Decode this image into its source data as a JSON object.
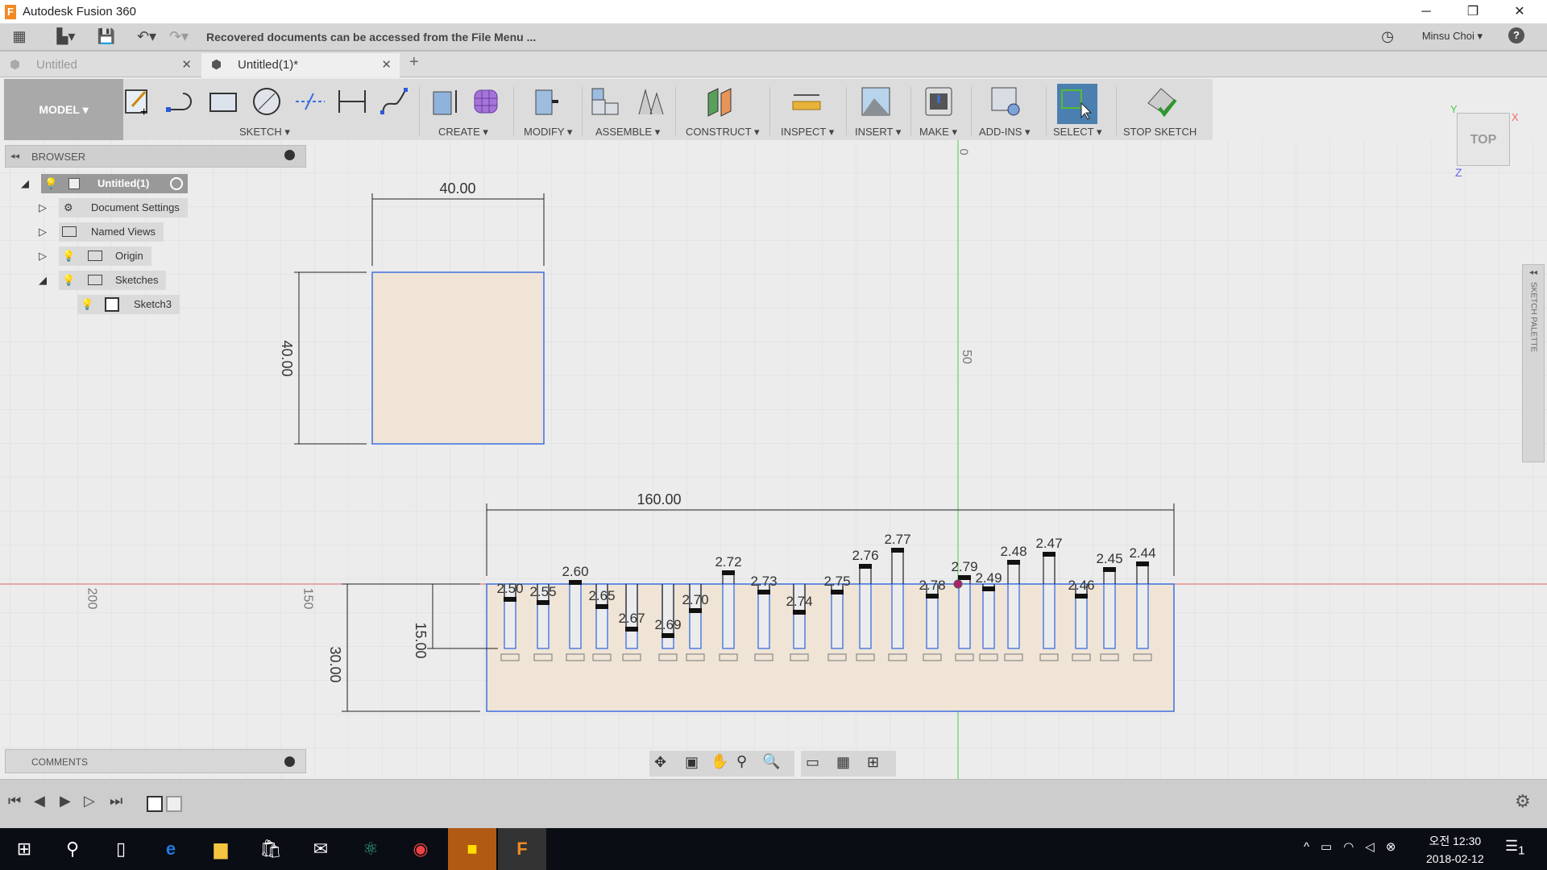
{
  "window": {
    "title": "Autodesk Fusion 360",
    "controls": [
      "─",
      "❐",
      "✕"
    ]
  },
  "quickbar": {
    "message": "Recovered documents can be accessed from the File Menu ...",
    "user": "Minsu Choi ▾",
    "help": "?"
  },
  "tabs": [
    {
      "label": "Untitled",
      "active": false
    },
    {
      "label": "Untitled(1)*",
      "active": true
    }
  ],
  "toolbar": {
    "workspace": "MODEL ▾",
    "groups": [
      "SKETCH ▾",
      "CREATE ▾",
      "MODIFY ▾",
      "ASSEMBLE ▾",
      "CONSTRUCT ▾",
      "INSPECT ▾",
      "INSERT ▾",
      "MAKE ▾",
      "ADD-INS ▾",
      "SELECT ▾",
      "STOP SKETCH"
    ]
  },
  "browser": {
    "title": "BROWSER",
    "items": [
      {
        "label": "Untitled(1)",
        "icon": "component-icon"
      },
      {
        "label": "Document Settings",
        "icon": "gear-icon"
      },
      {
        "label": "Named Views",
        "icon": "folder-icon"
      },
      {
        "label": "Origin",
        "icon": "folder-icon"
      },
      {
        "label": "Sketches",
        "icon": "folder-icon"
      },
      {
        "label": "Sketch3",
        "icon": "sketch-icon"
      }
    ]
  },
  "comments": {
    "title": "COMMENTS"
  },
  "viewcube": {
    "face": "TOP",
    "axes": {
      "x": "X",
      "y": "Y",
      "z": "Z"
    }
  },
  "palette": {
    "label": "SKETCH PALETTE"
  },
  "canvas": {
    "axis_labels": {
      "top": "0",
      "mid": "50",
      "left200": "200",
      "left150": "150"
    },
    "square": {
      "width": "40.00",
      "height": "40.00"
    },
    "rect": {
      "width": "160.00",
      "height": "30.00",
      "inner": "15.00"
    },
    "slot_dims": [
      "2.50",
      "2.55",
      "2.60",
      "2.65",
      "2.67",
      "2.69",
      "2.70",
      "2.72",
      "2.73",
      "2.74",
      "2.75",
      "2.76",
      "2.77",
      "2.78",
      "2.79",
      "2.49",
      "2.48",
      "2.47",
      "2.46",
      "2.45",
      "2.44"
    ]
  },
  "colors": {
    "sketch_line": "#3b6fe0",
    "fill": "#efe4d6",
    "x_axis": "#e06060",
    "y_axis": "#4cc94c",
    "select_active": "#4a7fb0"
  },
  "taskbar": {
    "time": "오전 12:30",
    "date": "2018-02-12",
    "notifications": "1"
  }
}
